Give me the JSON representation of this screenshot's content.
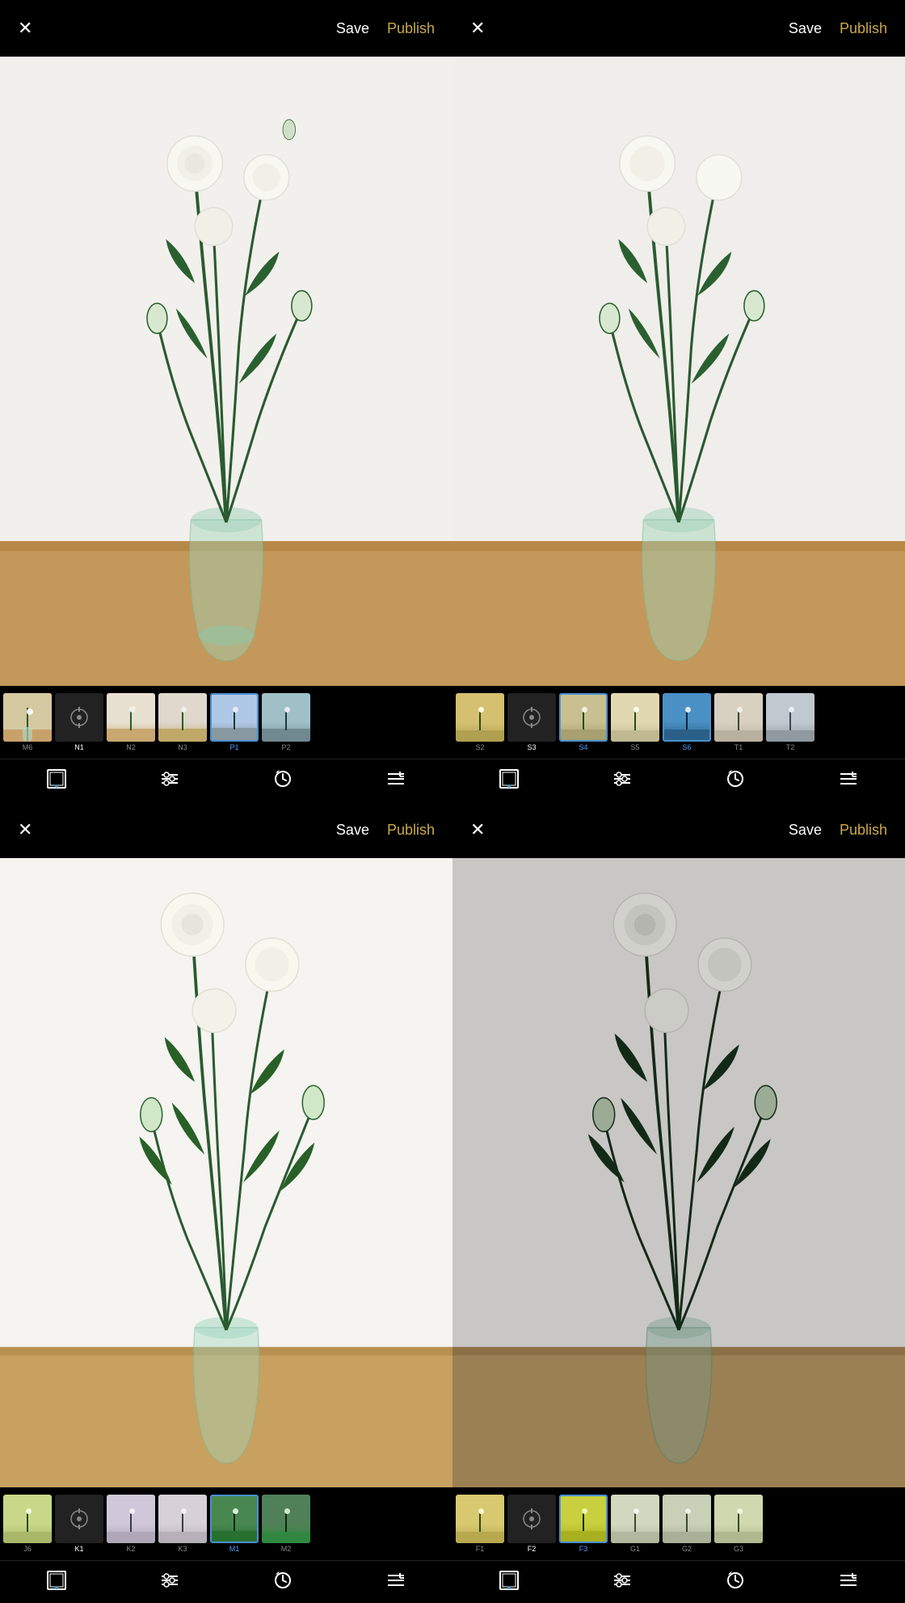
{
  "panels": [
    {
      "id": "tl",
      "position": "top-left",
      "header": {
        "close": "×",
        "save": "Save",
        "publish": "Publish"
      },
      "photo_style": "normal",
      "filters": [
        {
          "id": "M6",
          "active": false,
          "style": "m6"
        },
        {
          "id": "N1",
          "active": false,
          "style": "n1",
          "is_adjust": true
        },
        {
          "id": "N2",
          "active": false,
          "style": "n2"
        },
        {
          "id": "N3",
          "active": false,
          "style": "n3"
        },
        {
          "id": "P1",
          "active": true,
          "style": "p1"
        },
        {
          "id": "P2",
          "active": false,
          "style": "p2"
        }
      ],
      "toolbar": [
        "frame",
        "adjust",
        "history",
        "presets"
      ]
    },
    {
      "id": "tr",
      "position": "top-right",
      "header": {
        "close": "×",
        "save": "Save",
        "publish": "Publish"
      },
      "photo_style": "normal",
      "filters": [
        {
          "id": "S2",
          "active": false,
          "style": "s2"
        },
        {
          "id": "S3",
          "active": false,
          "style": "s3",
          "is_adjust": true
        },
        {
          "id": "S4",
          "active": true,
          "style": "s4"
        },
        {
          "id": "S5",
          "active": false,
          "style": "s5"
        },
        {
          "id": "S6",
          "active": true,
          "style": "s6"
        },
        {
          "id": "T1",
          "active": false,
          "style": "t1"
        },
        {
          "id": "T2",
          "active": false,
          "style": "t2"
        }
      ],
      "toolbar": [
        "frame",
        "adjust",
        "history",
        "presets"
      ]
    },
    {
      "id": "bl",
      "position": "bottom-left",
      "header": {
        "close": "×",
        "save": "Save",
        "publish": "Publish"
      },
      "photo_style": "normal",
      "filters": [
        {
          "id": "J6",
          "active": false,
          "style": "j6"
        },
        {
          "id": "K1",
          "active": false,
          "style": "k1",
          "is_adjust": true
        },
        {
          "id": "K2",
          "active": false,
          "style": "k2"
        },
        {
          "id": "K3",
          "active": false,
          "style": "k3"
        },
        {
          "id": "M1",
          "active": true,
          "style": "m1"
        },
        {
          "id": "M2",
          "active": false,
          "style": "m2"
        }
      ],
      "toolbar": [
        "frame",
        "adjust",
        "history",
        "presets"
      ]
    },
    {
      "id": "br",
      "position": "bottom-right",
      "header": {
        "close": "×",
        "save": "Save",
        "publish": "Publish"
      },
      "photo_style": "dark",
      "filters": [
        {
          "id": "F1",
          "active": false,
          "style": "f1"
        },
        {
          "id": "F2",
          "active": false,
          "style": "f2",
          "is_adjust": true
        },
        {
          "id": "F3",
          "active": true,
          "style": "f3"
        },
        {
          "id": "G1",
          "active": false,
          "style": "g1"
        },
        {
          "id": "G2",
          "active": false,
          "style": "g2"
        },
        {
          "id": "G3",
          "active": false,
          "style": "g3"
        }
      ],
      "toolbar": [
        "frame",
        "adjust",
        "history",
        "presets"
      ]
    }
  ],
  "colors": {
    "accent": "#c8a84b",
    "active_filter": "#4a90d0",
    "background": "#000000",
    "text_primary": "#ffffff",
    "text_muted": "#888888"
  }
}
